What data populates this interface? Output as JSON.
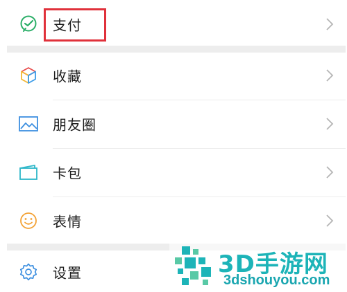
{
  "menu": {
    "items": [
      {
        "label": "支付",
        "icon": "wechat-pay-icon"
      },
      {
        "label": "收藏",
        "icon": "favorites-cube-icon"
      },
      {
        "label": "朋友圈",
        "icon": "moments-picture-icon"
      },
      {
        "label": "卡包",
        "icon": "card-wallet-icon"
      },
      {
        "label": "表情",
        "icon": "smiley-icon"
      },
      {
        "label": "设置",
        "icon": "gear-icon"
      }
    ]
  },
  "watermark": {
    "title": "3D手游网",
    "url": "3dshouyou.com"
  },
  "colors": {
    "highlight": "#e0313b",
    "pay_green": "#2aae67",
    "watermark_teal": "#1db4b8"
  }
}
